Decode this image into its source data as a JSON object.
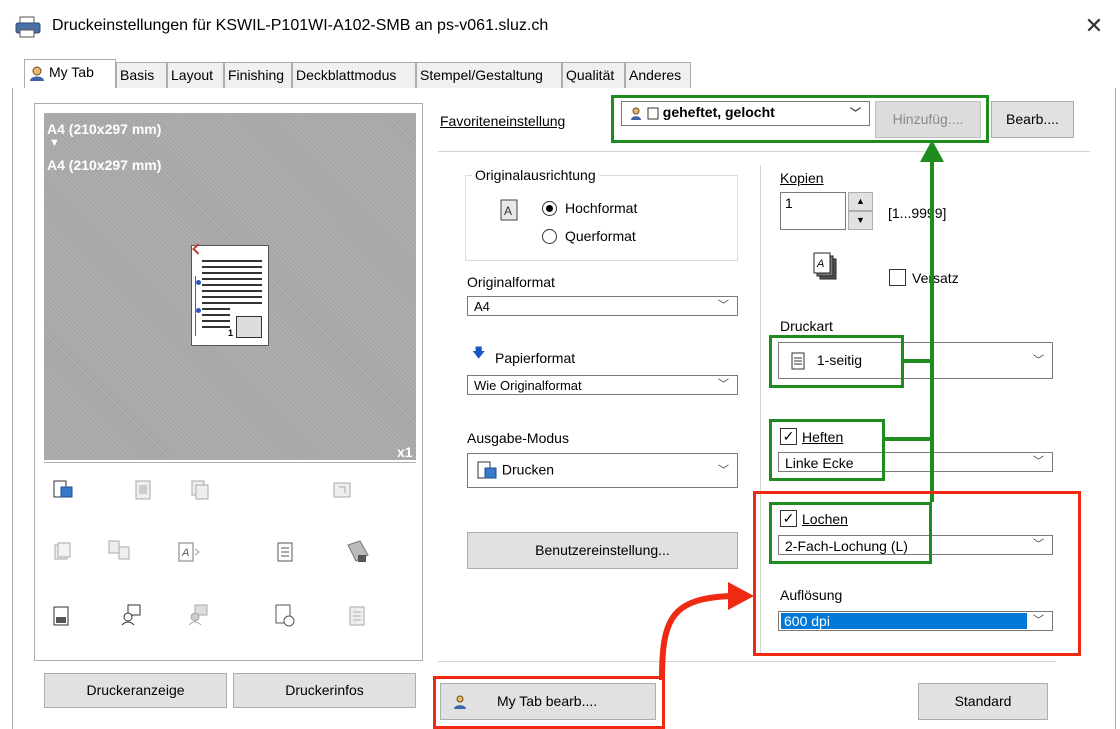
{
  "window": {
    "title": "Druckeinstellungen für KSWIL-P101WI-A102-SMB an ps-v061.sluz.ch",
    "close_glyph": "✕"
  },
  "tabs": [
    {
      "label": "My Tab"
    },
    {
      "label": "Basis"
    },
    {
      "label": "Layout"
    },
    {
      "label": "Finishing"
    },
    {
      "label": "Deckblattmodus"
    },
    {
      "label": "Stempel/Gestaltung"
    },
    {
      "label": "Qualität"
    },
    {
      "label": "Anderes"
    }
  ],
  "preview": {
    "line1": "A4 (210x297 mm)",
    "arrow": "▼",
    "line2": "A4 (210x297 mm)",
    "count": "x1",
    "page_number": "1"
  },
  "buttons": {
    "druckeranzeige": "Druckeranzeige",
    "druckerinfos": "Druckerinfos",
    "hinzufuegen": "Hinzufüg....",
    "bearb": "Bearb....",
    "benutzereinstellung": "Benutzereinstellung...",
    "mytab_bearb": "My Tab bearb....",
    "standard": "Standard"
  },
  "favorites": {
    "label": "Favoriteneinstellung",
    "value": "geheftet, gelocht"
  },
  "orientation": {
    "group_label": "Originalausrichtung",
    "portrait": "Hochformat",
    "landscape": "Querformat",
    "selected": "Hochformat"
  },
  "original_format": {
    "label": "Originalformat",
    "value": "A4"
  },
  "paper_format": {
    "label": "Papierformat",
    "value": "Wie Originalformat"
  },
  "output_mode": {
    "label": "Ausgabe-Modus",
    "value": "Drucken"
  },
  "copies": {
    "label": "Kopien",
    "value": "1",
    "range": "[1...9999]"
  },
  "offset": {
    "label": "Versatz",
    "checked": false
  },
  "print_type": {
    "label": "Druckart",
    "value": "1-seitig"
  },
  "staple": {
    "label": "Heften",
    "checked": true,
    "value": "Linke Ecke"
  },
  "punch": {
    "label": "Lochen",
    "checked": true,
    "value": "2-Fach-Lochung (L)"
  },
  "resolution": {
    "label": "Auflösung",
    "value": "600 dpi"
  },
  "colors": {
    "annotation_green": "#1e8c1e",
    "annotation_red": "#ef2a12",
    "selection_blue": "#0078d7",
    "preview_gray": "#a6a6a6"
  }
}
